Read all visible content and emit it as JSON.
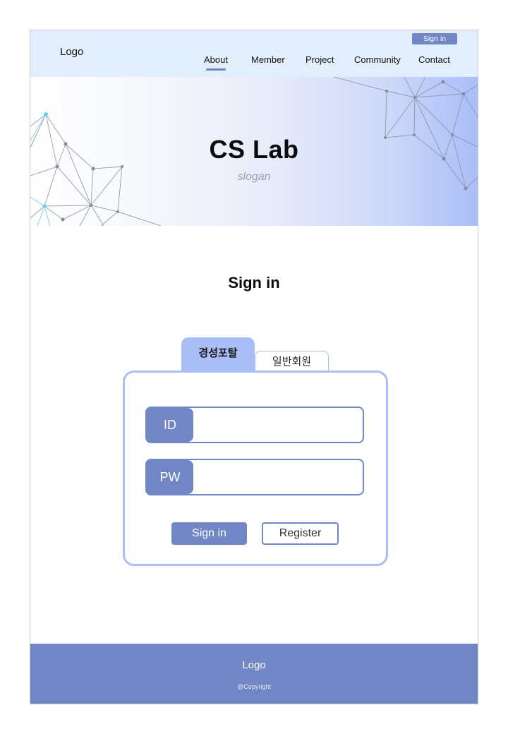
{
  "header": {
    "logo": "Logo",
    "sign_in_button": "Sign in",
    "nav": [
      "About",
      "Member",
      "Project",
      "Community",
      "Contact"
    ],
    "active_nav": "About"
  },
  "hero": {
    "title": "CS Lab",
    "slogan": "slogan"
  },
  "main": {
    "title": "Sign in",
    "tabs": [
      "경성포탈",
      "일반회원"
    ],
    "active_tab": "경성포탈",
    "fields": {
      "id_label": "ID",
      "id_value": "",
      "pw_label": "PW",
      "pw_value": ""
    },
    "buttons": {
      "sign_in": "Sign in",
      "register": "Register"
    }
  },
  "footer": {
    "logo": "Logo",
    "copyright": "@Copyright"
  },
  "colors": {
    "accent": "#7186c5",
    "accent_light": "#a9bdf7",
    "header_bg": "#e3eefc"
  }
}
